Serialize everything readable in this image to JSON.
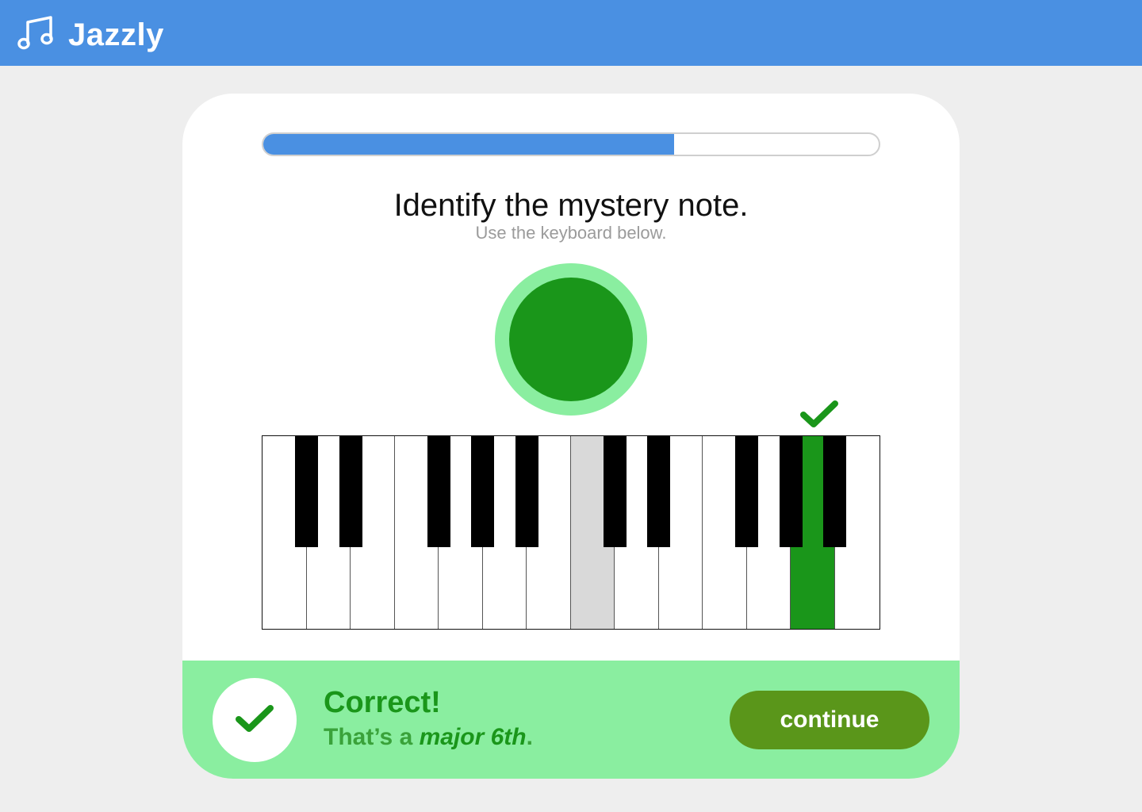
{
  "app": {
    "name": "Jazzly",
    "logo_icon": "music-notes-icon",
    "colors": {
      "brand": "#4a90e2",
      "success": "#1a961a",
      "success_light": "#8aeea0",
      "continue_button": "#5a961a"
    }
  },
  "lesson": {
    "progress": 0.667,
    "question": "Identify the mystery note.",
    "hint": "Use the keyboard below.",
    "play_button_icon": "play-note-icon"
  },
  "keyboard": {
    "white_keys": 14,
    "highlighted_key_index": 7,
    "correct_key_index": 12,
    "correct_marker_icon": "checkmark-icon"
  },
  "feedback": {
    "title": "Correct!",
    "subtitle_prefix": "That’s a ",
    "subtitle_emphasis": "major 6th",
    "subtitle_suffix": ".",
    "icon": "checkmark-icon",
    "continue_label": "continue"
  }
}
